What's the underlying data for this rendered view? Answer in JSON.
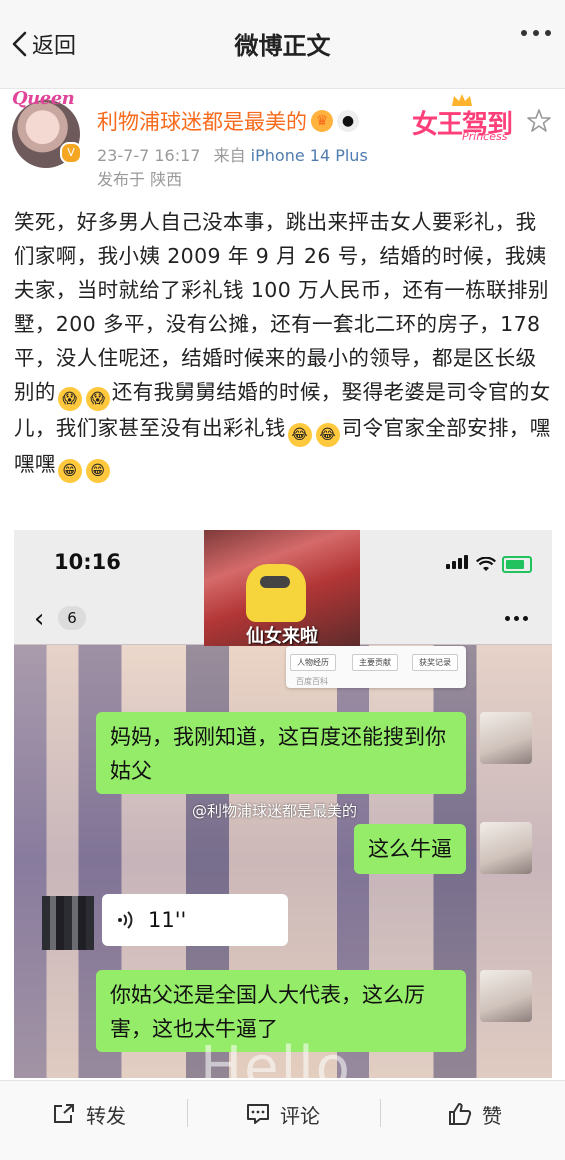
{
  "nav": {
    "back_label": "返回",
    "title": "微博正文"
  },
  "user": {
    "avatar_text": "Queen",
    "name": "利物浦球迷都是最美的",
    "date": "23-7-7 16:17",
    "from_prefix": "来自",
    "device": "iPhone 14 Plus",
    "location": "发布于 陕西",
    "badge_text": "女王驾到",
    "badge_sub": "Princess"
  },
  "post": {
    "text_1": "笑死，好多男人自己没本事，跳出来抨击女人要彩礼，我们家啊，我小姨 2009 年 9 月 26 号，结婚的时候，我姨夫家，当时就给了彩礼钱 100 万人民币，还有一栋联排别墅，200 多平，没有公摊，还有一套北二环的房子，178 平，没人住呢还，结婚时候来的最小的领导，都是区长级别的",
    "text_2": "还有我舅舅结婚的时候，娶得老婆是司令官的女儿，我们家甚至没有出彩礼钱",
    "text_3": "司令官家全部安排，嘿嘿嘿"
  },
  "screenshot": {
    "time": "10:16",
    "unread": "6",
    "video_caption": "仙女来啦",
    "baike_tabs": [
      "人物经历",
      "主要贡献",
      "获奖记录"
    ],
    "baike_hint": "百度百科",
    "messages": [
      {
        "side": "right",
        "text": "妈妈，我刚知道，这百度还能搜到你姑父"
      },
      {
        "side": "right",
        "text": "这么牛逼"
      },
      {
        "side": "left",
        "text": "11''"
      },
      {
        "side": "right",
        "text": "你姑父还是全国人大代表，这么厉害，这也太牛逼了"
      }
    ],
    "watermark": "@利物浦球迷都是最美的",
    "overlay_text": "Hello"
  },
  "footer": {
    "repost": "转发",
    "comment": "评论",
    "like": "赞"
  },
  "colors": {
    "username": "#f86b1d",
    "device": "#507daf",
    "bubble": "#95ec69"
  }
}
